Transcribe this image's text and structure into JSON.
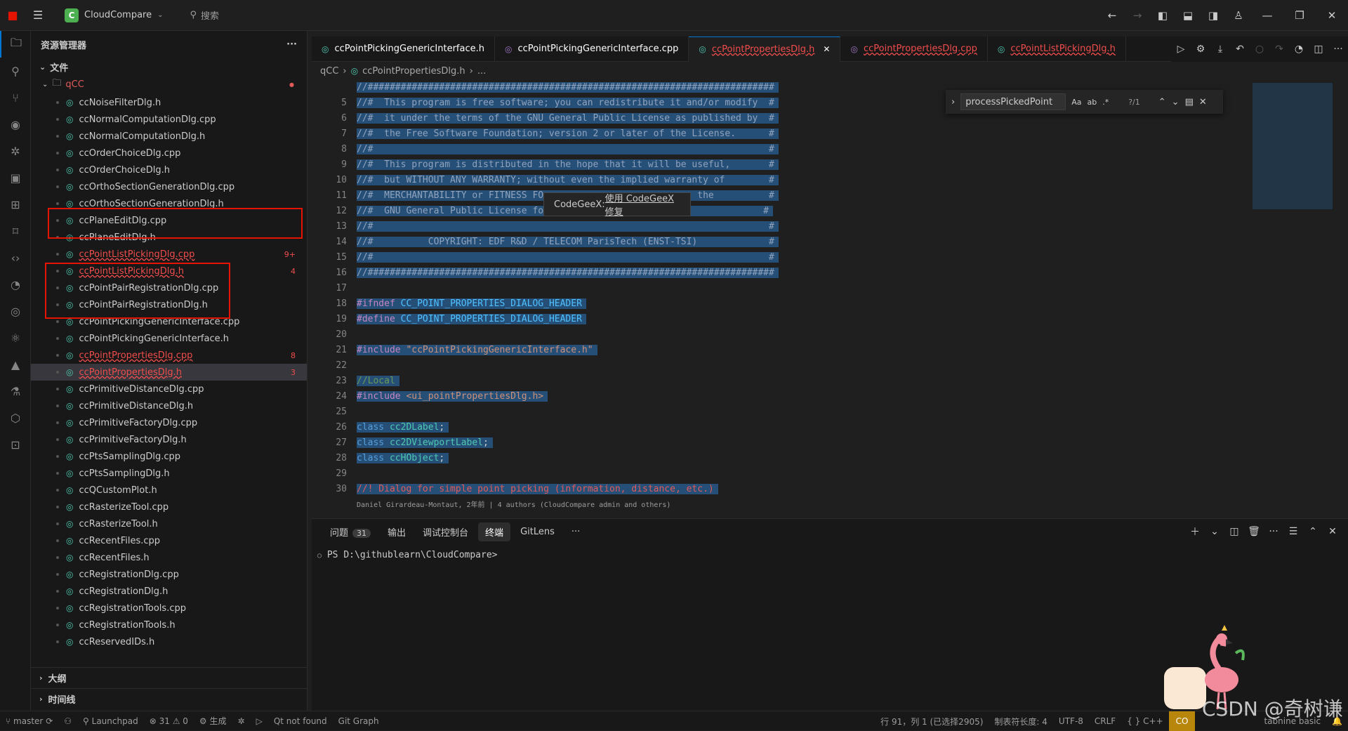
{
  "titlebar": {
    "app_name": "CloudCompare",
    "search_label": "搜索"
  },
  "sidebar": {
    "title": "资源管理器",
    "section_files": "文件",
    "root_folder": "qCC",
    "files": [
      {
        "name": "ccNoiseFilterDlg.h"
      },
      {
        "name": "ccNormalComputationDlg.cpp"
      },
      {
        "name": "ccNormalComputationDlg.h"
      },
      {
        "name": "ccOrderChoiceDlg.cpp"
      },
      {
        "name": "ccOrderChoiceDlg.h"
      },
      {
        "name": "ccOrthoSectionGenerationDlg.cpp"
      },
      {
        "name": "ccOrthoSectionGenerationDlg.h"
      },
      {
        "name": "ccPlaneEditDlg.cpp"
      },
      {
        "name": "ccPlaneEditDlg.h"
      },
      {
        "name": "ccPointListPickingDlg.cpp",
        "badge": "9+"
      },
      {
        "name": "ccPointListPickingDlg.h",
        "badge": "4"
      },
      {
        "name": "ccPointPairRegistrationDlg.cpp"
      },
      {
        "name": "ccPointPairRegistrationDlg.h"
      },
      {
        "name": "ccPointPickingGenericInterface.cpp"
      },
      {
        "name": "ccPointPickingGenericInterface.h"
      },
      {
        "name": "ccPointPropertiesDlg.cpp",
        "badge": "8"
      },
      {
        "name": "ccPointPropertiesDlg.h",
        "badge": "3"
      },
      {
        "name": "ccPrimitiveDistanceDlg.cpp"
      },
      {
        "name": "ccPrimitiveDistanceDlg.h"
      },
      {
        "name": "ccPrimitiveFactoryDlg.cpp"
      },
      {
        "name": "ccPrimitiveFactoryDlg.h"
      },
      {
        "name": "ccPtsSamplingDlg.cpp"
      },
      {
        "name": "ccPtsSamplingDlg.h"
      },
      {
        "name": "ccQCustomPlot.h"
      },
      {
        "name": "ccRasterizeTool.cpp"
      },
      {
        "name": "ccRasterizeTool.h"
      },
      {
        "name": "ccRecentFiles.cpp"
      },
      {
        "name": "ccRecentFiles.h"
      },
      {
        "name": "ccRegistrationDlg.cpp"
      },
      {
        "name": "ccRegistrationDlg.h"
      },
      {
        "name": "ccRegistrationTools.cpp"
      },
      {
        "name": "ccRegistrationTools.h"
      },
      {
        "name": "ccReservedIDs.h"
      }
    ],
    "section_outline": "大纲",
    "section_timeline": "时间线"
  },
  "tabs": [
    {
      "label": "ccPointPickingGenericInterface.h"
    },
    {
      "label": "ccPointPickingGenericInterface.cpp"
    },
    {
      "label": "ccPointPropertiesDlg.h"
    },
    {
      "label": "ccPointPropertiesDlg.cpp"
    },
    {
      "label": "ccPointListPickingDlg.h"
    }
  ],
  "breadcrumb": {
    "folder": "qCC",
    "file": "ccPointPropertiesDlg.h",
    "more": "..."
  },
  "editor": {
    "lines": [
      {
        "n": "",
        "text": "//##########################################################################"
      },
      {
        "n": "5",
        "text": "//#  This program is free software; you can redistribute it and/or modify  #"
      },
      {
        "n": "6",
        "text": "//#  it under the terms of the GNU General Public License as published by  #"
      },
      {
        "n": "7",
        "text": "//#  the Free Software Foundation; version 2 or later of the License.      #"
      },
      {
        "n": "8",
        "text": "//#                                                                        #"
      },
      {
        "n": "9",
        "text": "//#  This program is distributed in the hope that it will be useful,       #"
      },
      {
        "n": "10",
        "text": "//#  but WITHOUT ANY WARRANTY; without even the implied warranty of        #"
      },
      {
        "n": "11",
        "text": "//#  MERCHANTABILITY or FITNESS FO                            the          #"
      },
      {
        "n": "12",
        "text": "//#  GNU General Public License fo                                        #"
      },
      {
        "n": "13",
        "text": "//#                                                                        #"
      },
      {
        "n": "14",
        "text": "//#          COPYRIGHT: EDF R&D / TELECOM ParisTech (ENST-TSI)             #"
      },
      {
        "n": "15",
        "text": "//#                                                                        #"
      },
      {
        "n": "16",
        "text": "//##########################################################################"
      },
      {
        "n": "17",
        "text": ""
      },
      {
        "n": "18",
        "pp": "#ifndef",
        "rest": " CC_POINT_PROPERTIES_DIALOG_HEADER"
      },
      {
        "n": "19",
        "pp": "#define",
        "rest": " CC_POINT_PROPERTIES_DIALOG_HEADER"
      },
      {
        "n": "20",
        "text": ""
      },
      {
        "n": "21",
        "pp": "#include",
        "str": " \"ccPointPickingGenericInterface.h\""
      },
      {
        "n": "22",
        "text": ""
      },
      {
        "n": "23",
        "comment": "//Local"
      },
      {
        "n": "24",
        "pp": "#include",
        "str": " <ui_pointPropertiesDlg.h>"
      },
      {
        "n": "25",
        "text": ""
      },
      {
        "n": "26",
        "kw": "class",
        "type": " cc2DLabel",
        "end": ";"
      },
      {
        "n": "27",
        "kw": "class",
        "type": " cc2DViewportLabel",
        "end": ";"
      },
      {
        "n": "28",
        "kw": "class",
        "type": " ccHObject",
        "end": ";"
      },
      {
        "n": "29",
        "text": ""
      },
      {
        "n": "30",
        "doc": "//! Dialog for simple point picking (information, distance, etc.)"
      }
    ],
    "blame": "Daniel Girardeau-Montaut, 2年前 | 4 authors (CloudCompare admin and others)"
  },
  "find": {
    "query": "processPickedPoint",
    "match_case": "Aa",
    "whole_word": "ab",
    "regex": ".*",
    "result": "?/1"
  },
  "tooltip": {
    "prefix": "CodeGeeX: ",
    "link": "使用 CodeGeeX 修复"
  },
  "panel": {
    "tabs": [
      {
        "label": "问题",
        "count": "31"
      },
      {
        "label": "输出"
      },
      {
        "label": "调试控制台"
      },
      {
        "label": "终端"
      },
      {
        "label": "GitLens"
      }
    ],
    "more": "···",
    "prompt": "PS D:\\githublearn\\CloudCompare>"
  },
  "statusbar": {
    "branch": "master",
    "launchpad": "Launchpad",
    "errors": "31",
    "warnings": "0",
    "build": "生成",
    "qt": "Qt not found",
    "gitgraph": "Git Graph",
    "position": "行 91，列 1 (已选择2905)",
    "tabsize": "制表符长度: 4",
    "encoding": "UTF-8",
    "eol": "CRLF",
    "lang": "C++",
    "codegeex": "CO",
    "tabnine": "tabnine basic"
  },
  "watermark": "CSDN @奇树谦",
  "colors": {
    "accent": "#0078d4",
    "error": "#f14c4c",
    "selection": "#264f78"
  }
}
